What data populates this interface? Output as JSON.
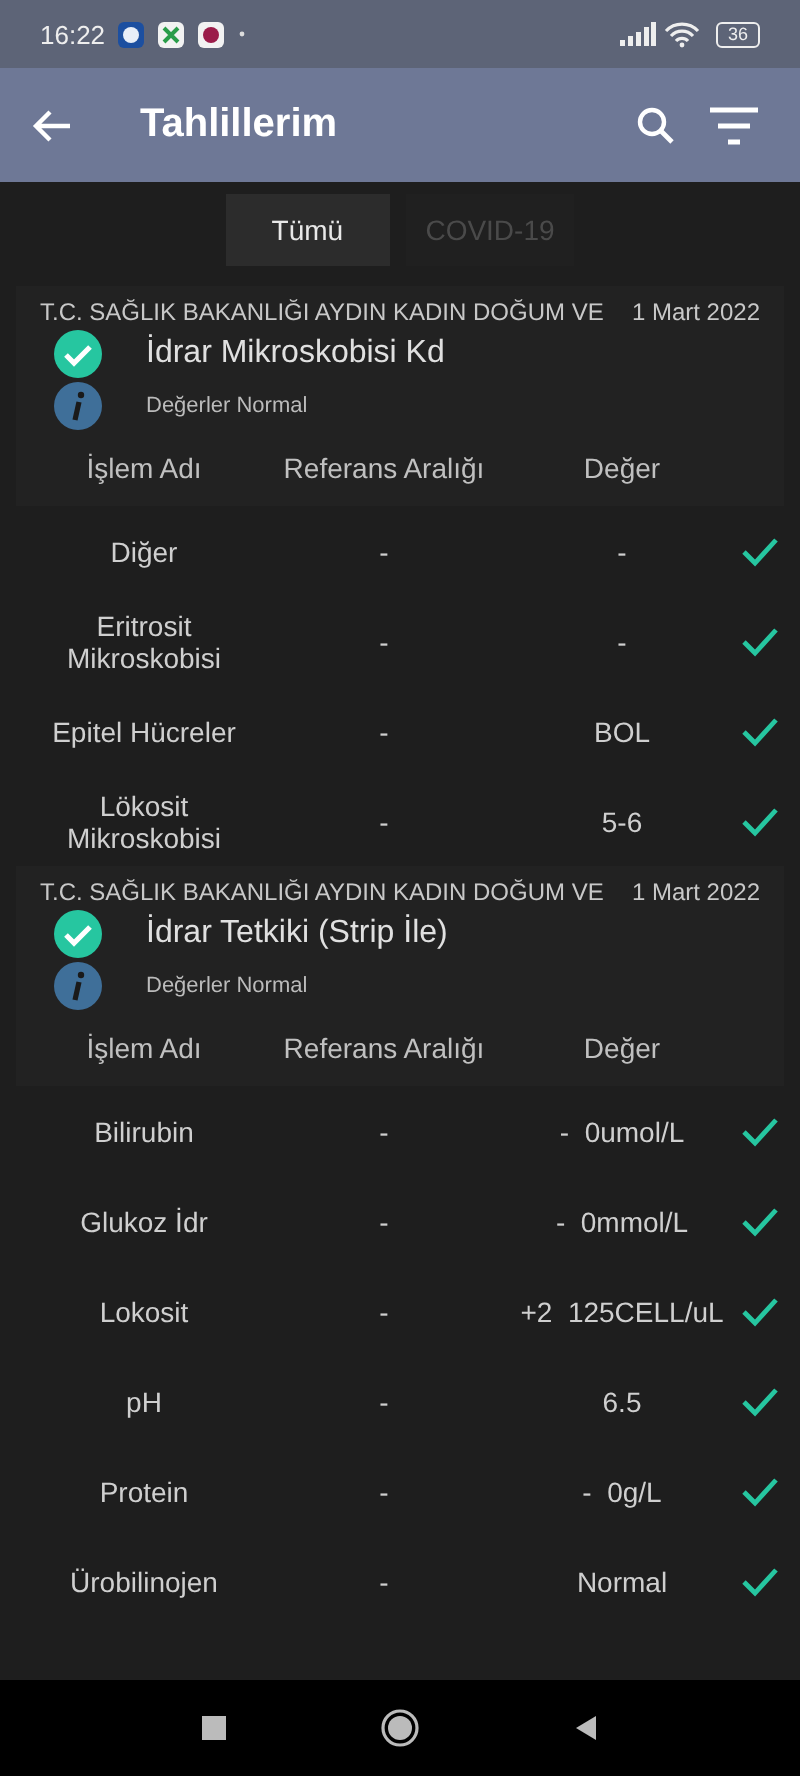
{
  "status_bar": {
    "time": "16:22",
    "battery": "36"
  },
  "app_bar": {
    "title": "Tahlillerim"
  },
  "tabs": [
    {
      "label": "Tümü",
      "selected": true
    },
    {
      "label": "COVID-19",
      "selected": false
    }
  ],
  "results": [
    {
      "institution": "T.C. SAĞLIK BAKANLIĞI AYDIN KADIN DOĞUM VE",
      "date": "1 Mart 2022",
      "title": "İdrar Mikroskobisi Kd",
      "normal": true,
      "summary": "Değerler Normal",
      "columns": [
        "İşlem Adı",
        "Referans Aralığı",
        "Değer"
      ],
      "rows": [
        {
          "name": "Diğer",
          "reference": "-",
          "value": "-",
          "normal": true
        },
        {
          "name": "Eritrosit Mikroskobisi",
          "reference": "-",
          "value": "-",
          "normal": true
        },
        {
          "name": "Epitel Hücreler",
          "reference": "-",
          "value": "BOL",
          "normal": true
        },
        {
          "name": "Lökosit Mikroskobisi",
          "reference": "-",
          "value": "5-6",
          "normal": true
        }
      ]
    },
    {
      "institution": "T.C. SAĞLIK BAKANLIĞI AYDIN KADIN DOĞUM VE",
      "date": "1 Mart 2022",
      "title": "İdrar Tetkiki (Strip İle)",
      "normal": true,
      "summary": "Değerler Normal",
      "columns": [
        "İşlem Adı",
        "Referans Aralığı",
        "Değer"
      ],
      "rows": [
        {
          "name": "Bilirubin",
          "reference": "-",
          "value": "-  0umol/L",
          "normal": true
        },
        {
          "name": "Glukoz İdr",
          "reference": "-",
          "value": "-  0mmol/L",
          "normal": true
        },
        {
          "name": "Lokosit",
          "reference": "-",
          "value": "+2  125CELL/uL",
          "normal": true
        },
        {
          "name": "pH",
          "reference": "-",
          "value": "6.5",
          "normal": true
        },
        {
          "name": "Protein",
          "reference": "-",
          "value": "-  0g/L",
          "normal": true
        },
        {
          "name": "Ürobilinojen",
          "reference": "-",
          "value": "Normal",
          "normal": true
        }
      ]
    }
  ]
}
